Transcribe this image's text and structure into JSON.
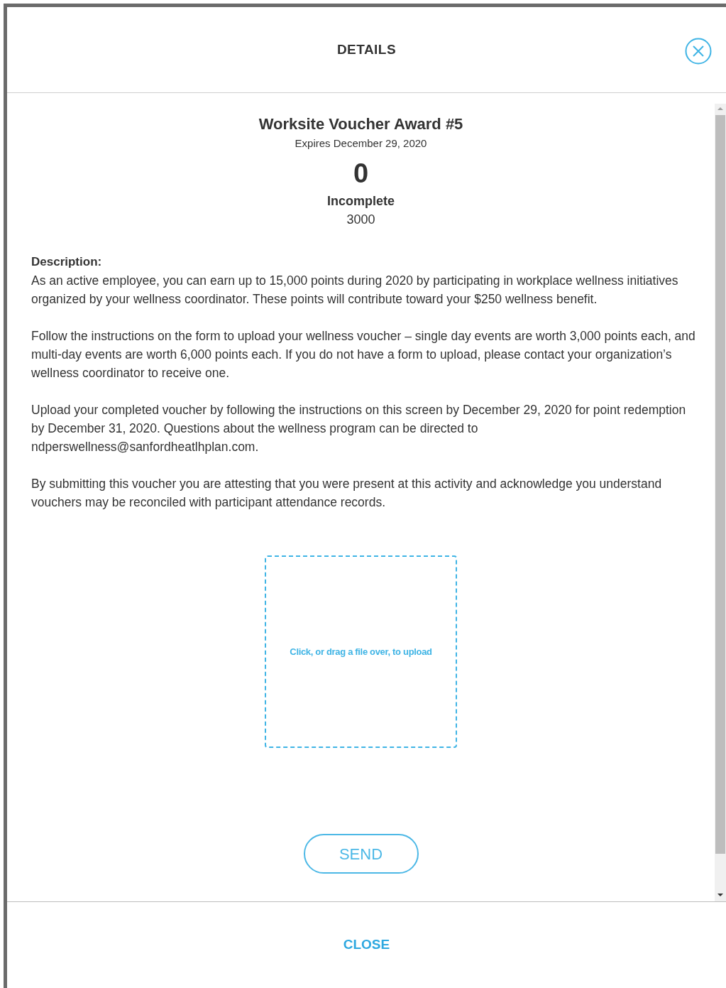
{
  "dialog": {
    "title": "DETAILS"
  },
  "award": {
    "title": "Worksite Voucher Award #5",
    "expires": "Expires December 29, 2020",
    "points": "0",
    "status": "Incomplete",
    "target": "3000"
  },
  "description": {
    "label": "Description:",
    "paragraphs": [
      "As an active employee, you can earn up to 15,000 points during 2020 by participating in workplace wellness initiatives organized by your wellness coordinator. These points will contribute toward your $250 wellness benefit.",
      "Follow the instructions on the form to upload your wellness voucher – single day events are worth 3,000 points each, and multi-day events are worth 6,000 points each. If you do not have a form to upload, please contact your organization’s wellness coordinator to receive one.",
      "Upload your completed voucher by following the instructions on this screen by December 29, 2020 for point redemption by December 31, 2020.  Questions about the wellness program can be directed to ndperswellness@sanfordheatlhplan.com.",
      "By submitting this voucher you are attesting that you were present at this activity and acknowledge you understand vouchers may be reconciled with participant attendance records."
    ]
  },
  "upload": {
    "prompt": "Click, or drag a file over, to upload"
  },
  "send_button": "SEND",
  "footer": {
    "close_button": "CLOSE"
  }
}
